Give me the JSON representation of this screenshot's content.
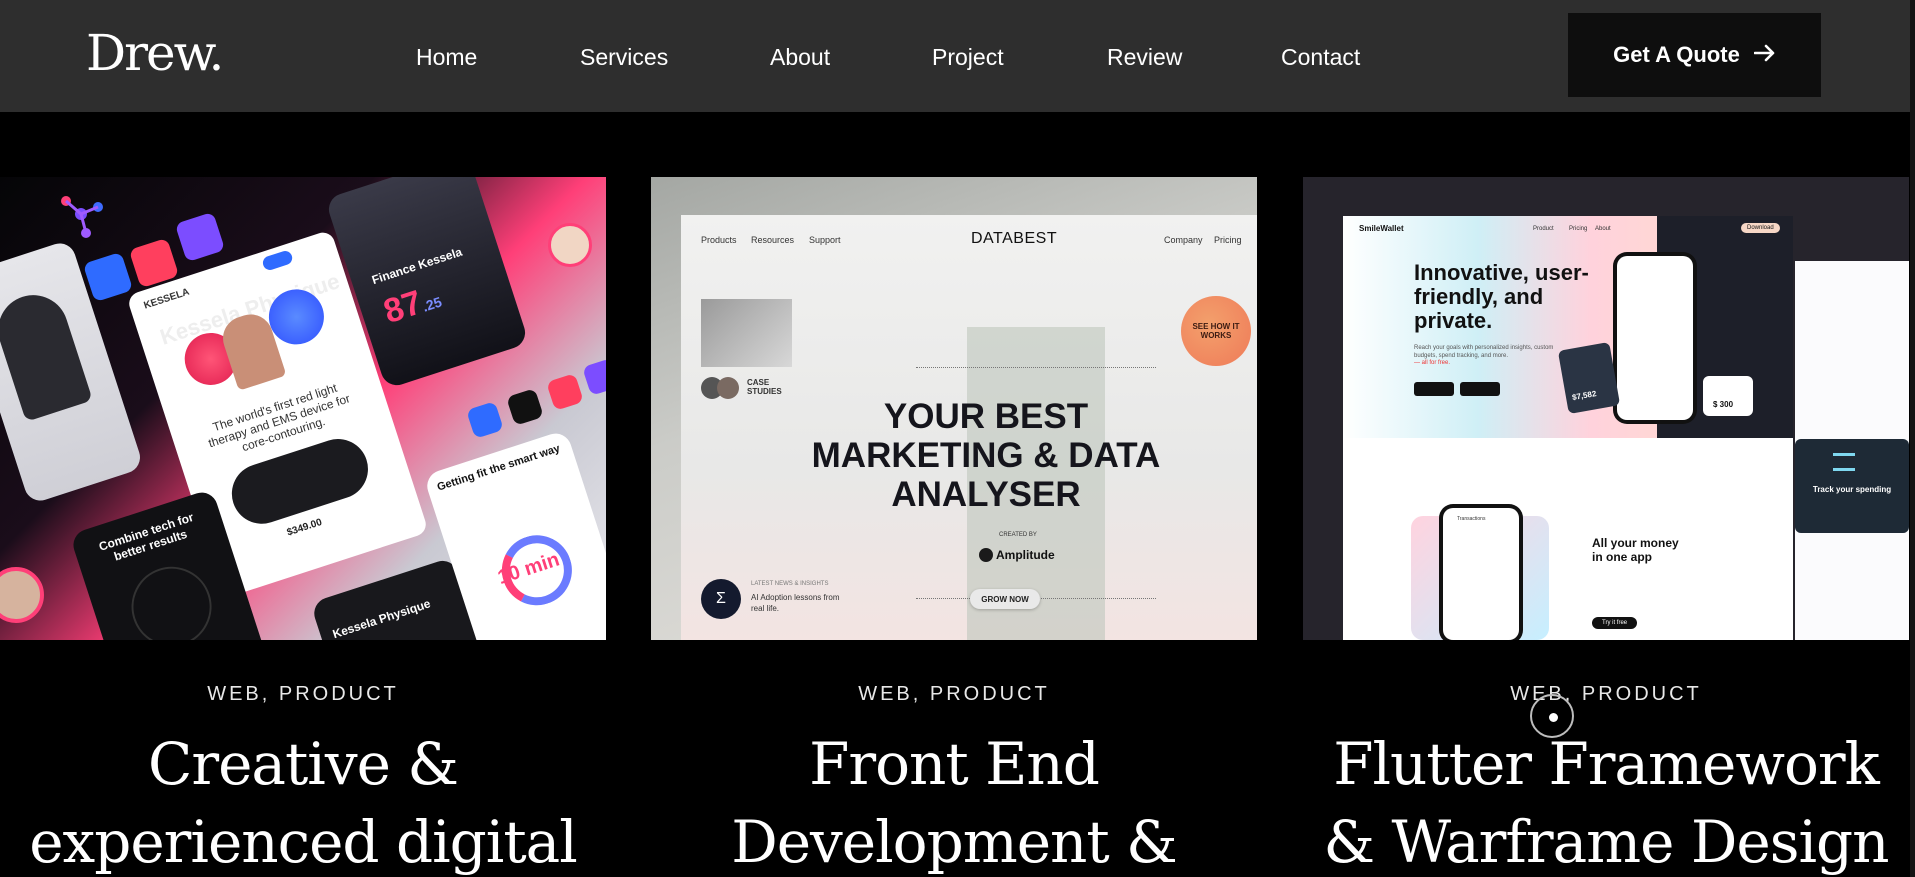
{
  "header": {
    "logo": "Drew.",
    "nav": [
      "Home",
      "Services",
      "About",
      "Project",
      "Review",
      "Contact"
    ],
    "cta_label": "Get A Quote",
    "cta_icon": "arrow-right-icon"
  },
  "projects": [
    {
      "tag": "WEB, PRODUCT",
      "title_line1": "Creative &",
      "title_line2": "experienced digital",
      "preview": {
        "brand": "KESSELA",
        "brand_heading": "Kessela Physique",
        "finance_title": "Finance Kessela",
        "price_big": "87",
        "price_cents": ".25",
        "tagline": "The world's first red light therapy and EMS device for core-contouring.",
        "product_price": "$349.00",
        "combine": "Combine tech for better results",
        "smart_way": "Getting fit the smart way",
        "timer": "10 min"
      }
    },
    {
      "tag": "WEB, PRODUCT",
      "title_line1": "Front End",
      "title_line2": "Development &",
      "preview": {
        "nav_left": [
          "Products",
          "Resources",
          "Support"
        ],
        "brand": "DATABEST",
        "nav_right": [
          "Company",
          "Pricing"
        ],
        "headline": "YOUR BEST MARKETING & DATA ANALYSER",
        "badge": "SEE HOW IT WORKS",
        "case_studies": "CASE STUDIES",
        "created_by": "CREATED BY",
        "partner": "Amplitude",
        "news_label": "LATEST NEWS & INSIGHTS",
        "news_title": "AI Adoption lessons from real life.",
        "cta": "GROW NOW"
      }
    },
    {
      "tag": "WEB, PRODUCT",
      "title_line1": "Flutter Framework",
      "title_line2": "& Warframe Design",
      "preview": {
        "brand": "SmileWallet",
        "nav": [
          "Product",
          "Pricing",
          "About"
        ],
        "download": "Download",
        "headline": "Innovative, user-friendly, and private.",
        "subline": "Reach your goals with personalized insights, custom budgets, spend tracking, and more.",
        "free": "— all for free.",
        "balance": "$7,582",
        "amount": "$ 300",
        "all_money": "All your money in one app",
        "track": "Track your spending",
        "try": "Try it free",
        "transactions": "Transactions"
      }
    }
  ],
  "colors": {
    "header_bg": "#2e2e2e",
    "page_bg": "#000000",
    "cta_bg": "#0e0e0e",
    "accent_pink": "#ff3f78"
  }
}
